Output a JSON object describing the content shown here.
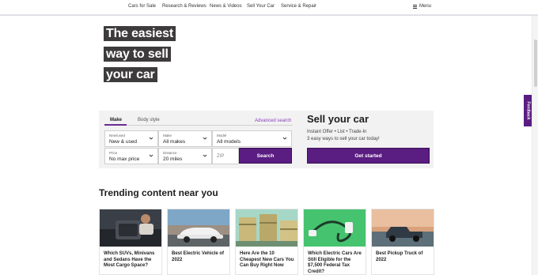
{
  "nav": {
    "items": [
      "Cars for Sale",
      "Research & Reviews",
      "News & Videos",
      "Sell Your Car",
      "Service & Repair"
    ],
    "menu_label": "Menu"
  },
  "hero": {
    "lines": [
      "The easiest",
      "way to sell",
      "your car"
    ]
  },
  "search": {
    "tabs": [
      "Make",
      "Body style"
    ],
    "advanced_link": "Advanced search",
    "fields": {
      "condition": {
        "label": "New/used",
        "value": "New & used"
      },
      "make": {
        "label": "Make",
        "value": "All makes"
      },
      "model": {
        "label": "Model",
        "value": "All models"
      },
      "price": {
        "label": "Price",
        "value": "No max price"
      },
      "distance": {
        "label": "Distance",
        "value": "20 miles"
      },
      "zip": {
        "placeholder": "ZIP"
      }
    },
    "button_label": "Search"
  },
  "sell": {
    "title": "Sell your car",
    "subtitle1": "Instant Offer • List • Trade-In",
    "subtitle2": "3 easy ways to sell your car today!",
    "button_label": "Get started"
  },
  "feedback_label": "Feedback",
  "trending": {
    "title": "Trending content near you",
    "cards": [
      {
        "title": "Which SUVs, Minivans and Sedans Have the Most Cargo Space?"
      },
      {
        "title": "Best Electric Vehicle of 2022"
      },
      {
        "title": "Here Are the 10 Cheapest New Cars You Can Buy Right Now"
      },
      {
        "title": "Which Electric Cars Are Still Eligible for the $7,500 Federal Tax Credit?"
      },
      {
        "title": "Best Pickup Truck of 2022"
      }
    ]
  },
  "colors": {
    "brand_purple": "#5a1d81",
    "hero_bg": "#3d3b3c",
    "link_purple": "#8a3fb8"
  }
}
